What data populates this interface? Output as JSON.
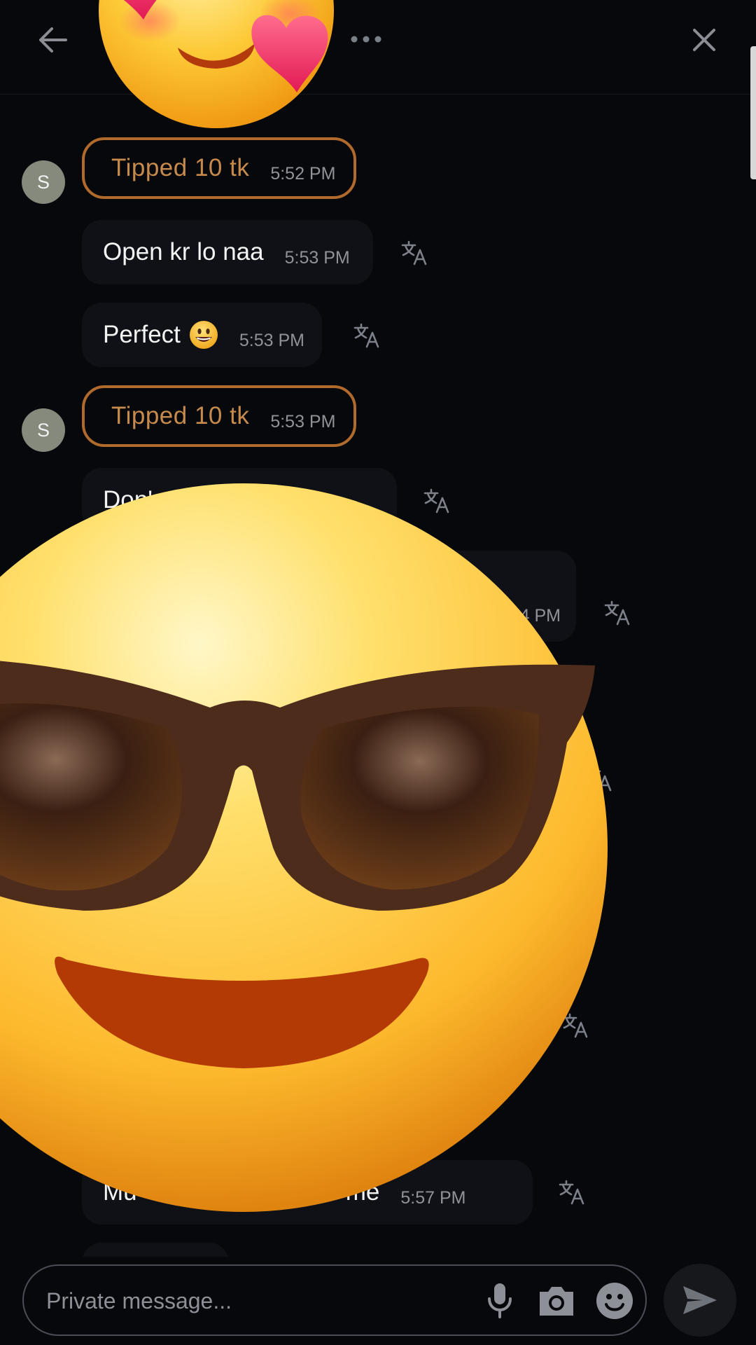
{
  "header": {
    "back_icon": "back-arrow-icon",
    "more_icon": "more-horizontal-icon",
    "close_icon": "close-icon"
  },
  "messages": [
    {
      "type": "tip",
      "avatar": "S",
      "text": "Tipped 10 tk",
      "time": "5:52 PM"
    },
    {
      "type": "text",
      "text": "Open kr lo naa",
      "time": "5:53 PM"
    },
    {
      "type": "text",
      "text": "Perfect",
      "time": "5:53 PM"
    },
    {
      "type": "tip",
      "avatar": "S",
      "text": "Tipped 10 tk",
      "time": "5:53 PM"
    },
    {
      "type": "text",
      "text": "Don'",
      "time": ""
    },
    {
      "type": "text",
      "text": "",
      "time": "4 PM"
    },
    {
      "type": "text",
      "text": "Mu",
      "tail": "une me",
      "time": "5:57 PM"
    }
  ],
  "composer": {
    "placeholder": "Private message...",
    "mic_icon": "microphone-icon",
    "camera_icon": "camera-icon",
    "emoji_icon": "emoji-icon",
    "send_icon": "send-icon"
  },
  "overlays": {
    "top_sticker": "smiling-face-with-hearts-icon",
    "center_sticker": "smiling-face-with-sunglasses-icon"
  },
  "colors": {
    "background": "#07080c",
    "tip_border": "#b06a2b",
    "tip_text": "#c58a4c",
    "bubble": "#0f1116"
  }
}
